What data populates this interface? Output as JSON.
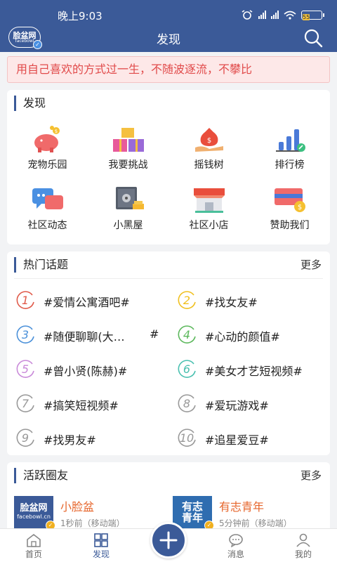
{
  "status_bar": {
    "time": "晚上9:03",
    "battery": "55"
  },
  "header": {
    "title": "发现",
    "logo_line1": "脸盆网",
    "logo_line2": "facebowl"
  },
  "motto": "用自己喜欢的方式过一生，不随波逐流，不攀比",
  "discover": {
    "title": "发现",
    "items": [
      {
        "label": "宠物乐园",
        "icon": "piggy-bank-icon"
      },
      {
        "label": "我要挑战",
        "icon": "gift-boxes-icon"
      },
      {
        "label": "摇钱树",
        "icon": "money-bag-icon"
      },
      {
        "label": "排行榜",
        "icon": "bar-chart-icon"
      },
      {
        "label": "社区动态",
        "icon": "chat-bubbles-icon"
      },
      {
        "label": "小黑屋",
        "icon": "safe-icon"
      },
      {
        "label": "社区小店",
        "icon": "shop-icon"
      },
      {
        "label": "赞助我们",
        "icon": "gift-card-icon"
      }
    ]
  },
  "topics": {
    "title": "热门话题",
    "more": "更多",
    "items": [
      {
        "num": "1",
        "text": "#爱情公寓酒吧#",
        "color": "#e05a4a"
      },
      {
        "num": "2",
        "text": "#找女友#",
        "color": "#f0c020"
      },
      {
        "num": "3",
        "text": "#随便聊聊(大…",
        "suffix": "#",
        "color": "#4a90d9"
      },
      {
        "num": "4",
        "text": "#心动的颜值#",
        "color": "#5cb85c"
      },
      {
        "num": "5",
        "text": "#曾小贤(陈赫)#",
        "color": "#c98ad9"
      },
      {
        "num": "6",
        "text": "#美女才艺短视频#",
        "color": "#4ac0b0"
      },
      {
        "num": "7",
        "text": "#搞笑短视频#",
        "color": "#999999"
      },
      {
        "num": "8",
        "text": "#爱玩游戏#",
        "color": "#999999"
      },
      {
        "num": "9",
        "text": "#找男友#",
        "color": "#999999"
      },
      {
        "num": "10",
        "text": "#追星爱豆#",
        "color": "#999999"
      }
    ]
  },
  "friends": {
    "title": "活跃圈友",
    "more": "更多",
    "items": [
      {
        "name": "小脸盆",
        "meta": "1秒前（移动端）",
        "avatar_line1": "脸盆网",
        "avatar_line2": "facebowl.cn"
      },
      {
        "name": "有志青年",
        "meta": "5分钟前（移动端）",
        "avatar_line1": "有志",
        "avatar_line2": "青年"
      }
    ]
  },
  "bottom_nav": {
    "items": [
      {
        "label": "首页",
        "icon": "home-icon"
      },
      {
        "label": "发现",
        "icon": "grid-icon",
        "active": true
      },
      {
        "label": "消息",
        "icon": "message-icon"
      },
      {
        "label": "我的",
        "icon": "user-icon"
      }
    ]
  },
  "colors": {
    "brand": "#3b5a98",
    "motto_text": "#e14a4a",
    "friend_name": "#e6662c"
  }
}
